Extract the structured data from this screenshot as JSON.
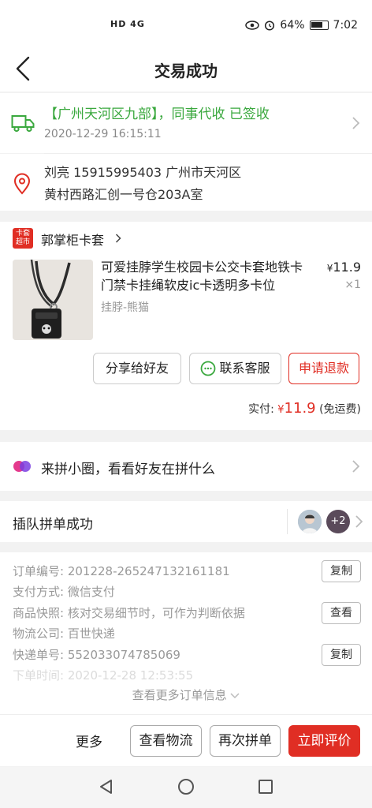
{
  "status_bar": {
    "network": "HD 4G",
    "battery": "64%",
    "time": "7:02"
  },
  "header": {
    "title": "交易成功"
  },
  "logistics": {
    "status": "【广州天河区九部】，同事代收 已签收",
    "time": "2020-12-29 16:15:11"
  },
  "address": {
    "line1": "刘亮  15915995403  广州市天河区",
    "line2": "黄村西路汇创一号仓203A室"
  },
  "shop": {
    "badge_line1": "卡套",
    "badge_line2": "超市",
    "name": "郭掌柜卡套"
  },
  "product": {
    "title": "可爱挂脖学生校园卡公交卡套地铁卡门禁卡挂绳软皮ic卡透明多卡位",
    "spec": "挂脖-熊猫",
    "currency": "¥",
    "price": "11.9",
    "qty": "×1"
  },
  "actions": {
    "share": "分享给好友",
    "service": "联系客服",
    "refund": "申请退款"
  },
  "payment": {
    "label": "实付: ",
    "currency": "¥",
    "amount": "11.9",
    "note": " (免运费)"
  },
  "circle": {
    "text": "来拼小圈，看看好友在拼什么"
  },
  "group": {
    "text": "插队拼单成功",
    "extra_count": "+2"
  },
  "order": {
    "rows": [
      {
        "label": "订单编号: ",
        "value": "201228-265247132161181",
        "button": "复制"
      },
      {
        "label": "支付方式: ",
        "value": "微信支付"
      },
      {
        "label": "商品快照: ",
        "value": "核对交易细节时，可作为判断依据",
        "button": "查看"
      },
      {
        "label": "物流公司: ",
        "value": "百世快递"
      },
      {
        "label": "快递单号: ",
        "value": "552033074785069",
        "button": "复制"
      },
      {
        "label": "下单时间: ",
        "value": "2020-12-28 12:53:55"
      }
    ],
    "more": "查看更多订单信息"
  },
  "bottom_bar": {
    "more": "更多",
    "logistics": "查看物流",
    "rebuy": "再次拼单",
    "review": "立即评价"
  },
  "colors": {
    "brand_red": "#e02e24",
    "logistics_green": "#3aa83e"
  }
}
